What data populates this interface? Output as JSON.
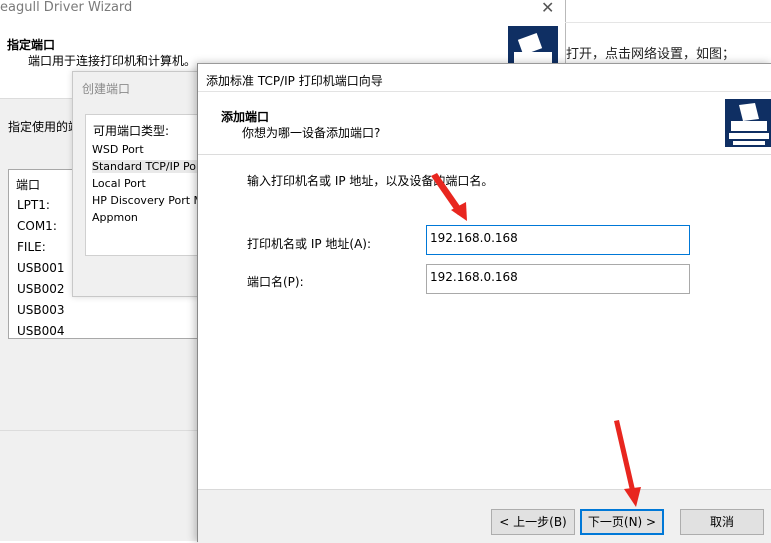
{
  "wizard": {
    "title": "eagull Driver Wizard",
    "close_glyph": "✕",
    "header_title": "指定端口",
    "header_subtitle": "端口用于连接打印机和计算机。",
    "logo_icon": "printer-logo-icon",
    "port_label": "指定使用的端",
    "port_list": {
      "header": "端口",
      "rows": [
        "LPT1:",
        "COM1:",
        "FILE:",
        "USB001",
        "USB002",
        "USB003",
        "USB004"
      ]
    }
  },
  "background_text": "打开，点击网络设置，如图；",
  "create_port_dialog": {
    "title": "创建端口",
    "group_label": "可用端口类型:",
    "options": [
      "WSD Port",
      "Standard TCP/IP Port",
      "Local Port",
      "HP Discovery Port Mor",
      "Appmon"
    ],
    "selected_index": 1
  },
  "tcp_wizard": {
    "title": "添加标准 TCP/IP 打印机端口向导",
    "header_title": "添加端口",
    "header_subtitle": "你想为哪一设备添加端口?",
    "logo_icon": "printer-logo-icon",
    "intro": "输入打印机名或 IP 地址，以及设备的端口名。",
    "printer_label": "打印机名或 IP 地址(A):",
    "printer_value": "192.168.0.168",
    "port_label": "端口名(P):",
    "port_value": "192.168.0.168",
    "back_button": "< 上一步(B)",
    "next_button": "下一页(N) >",
    "cancel_button": "取消"
  },
  "colors": {
    "annotation_arrow": "#e8261f",
    "focus_blue": "#0078d7",
    "logo_navy": "#0f2f63"
  }
}
